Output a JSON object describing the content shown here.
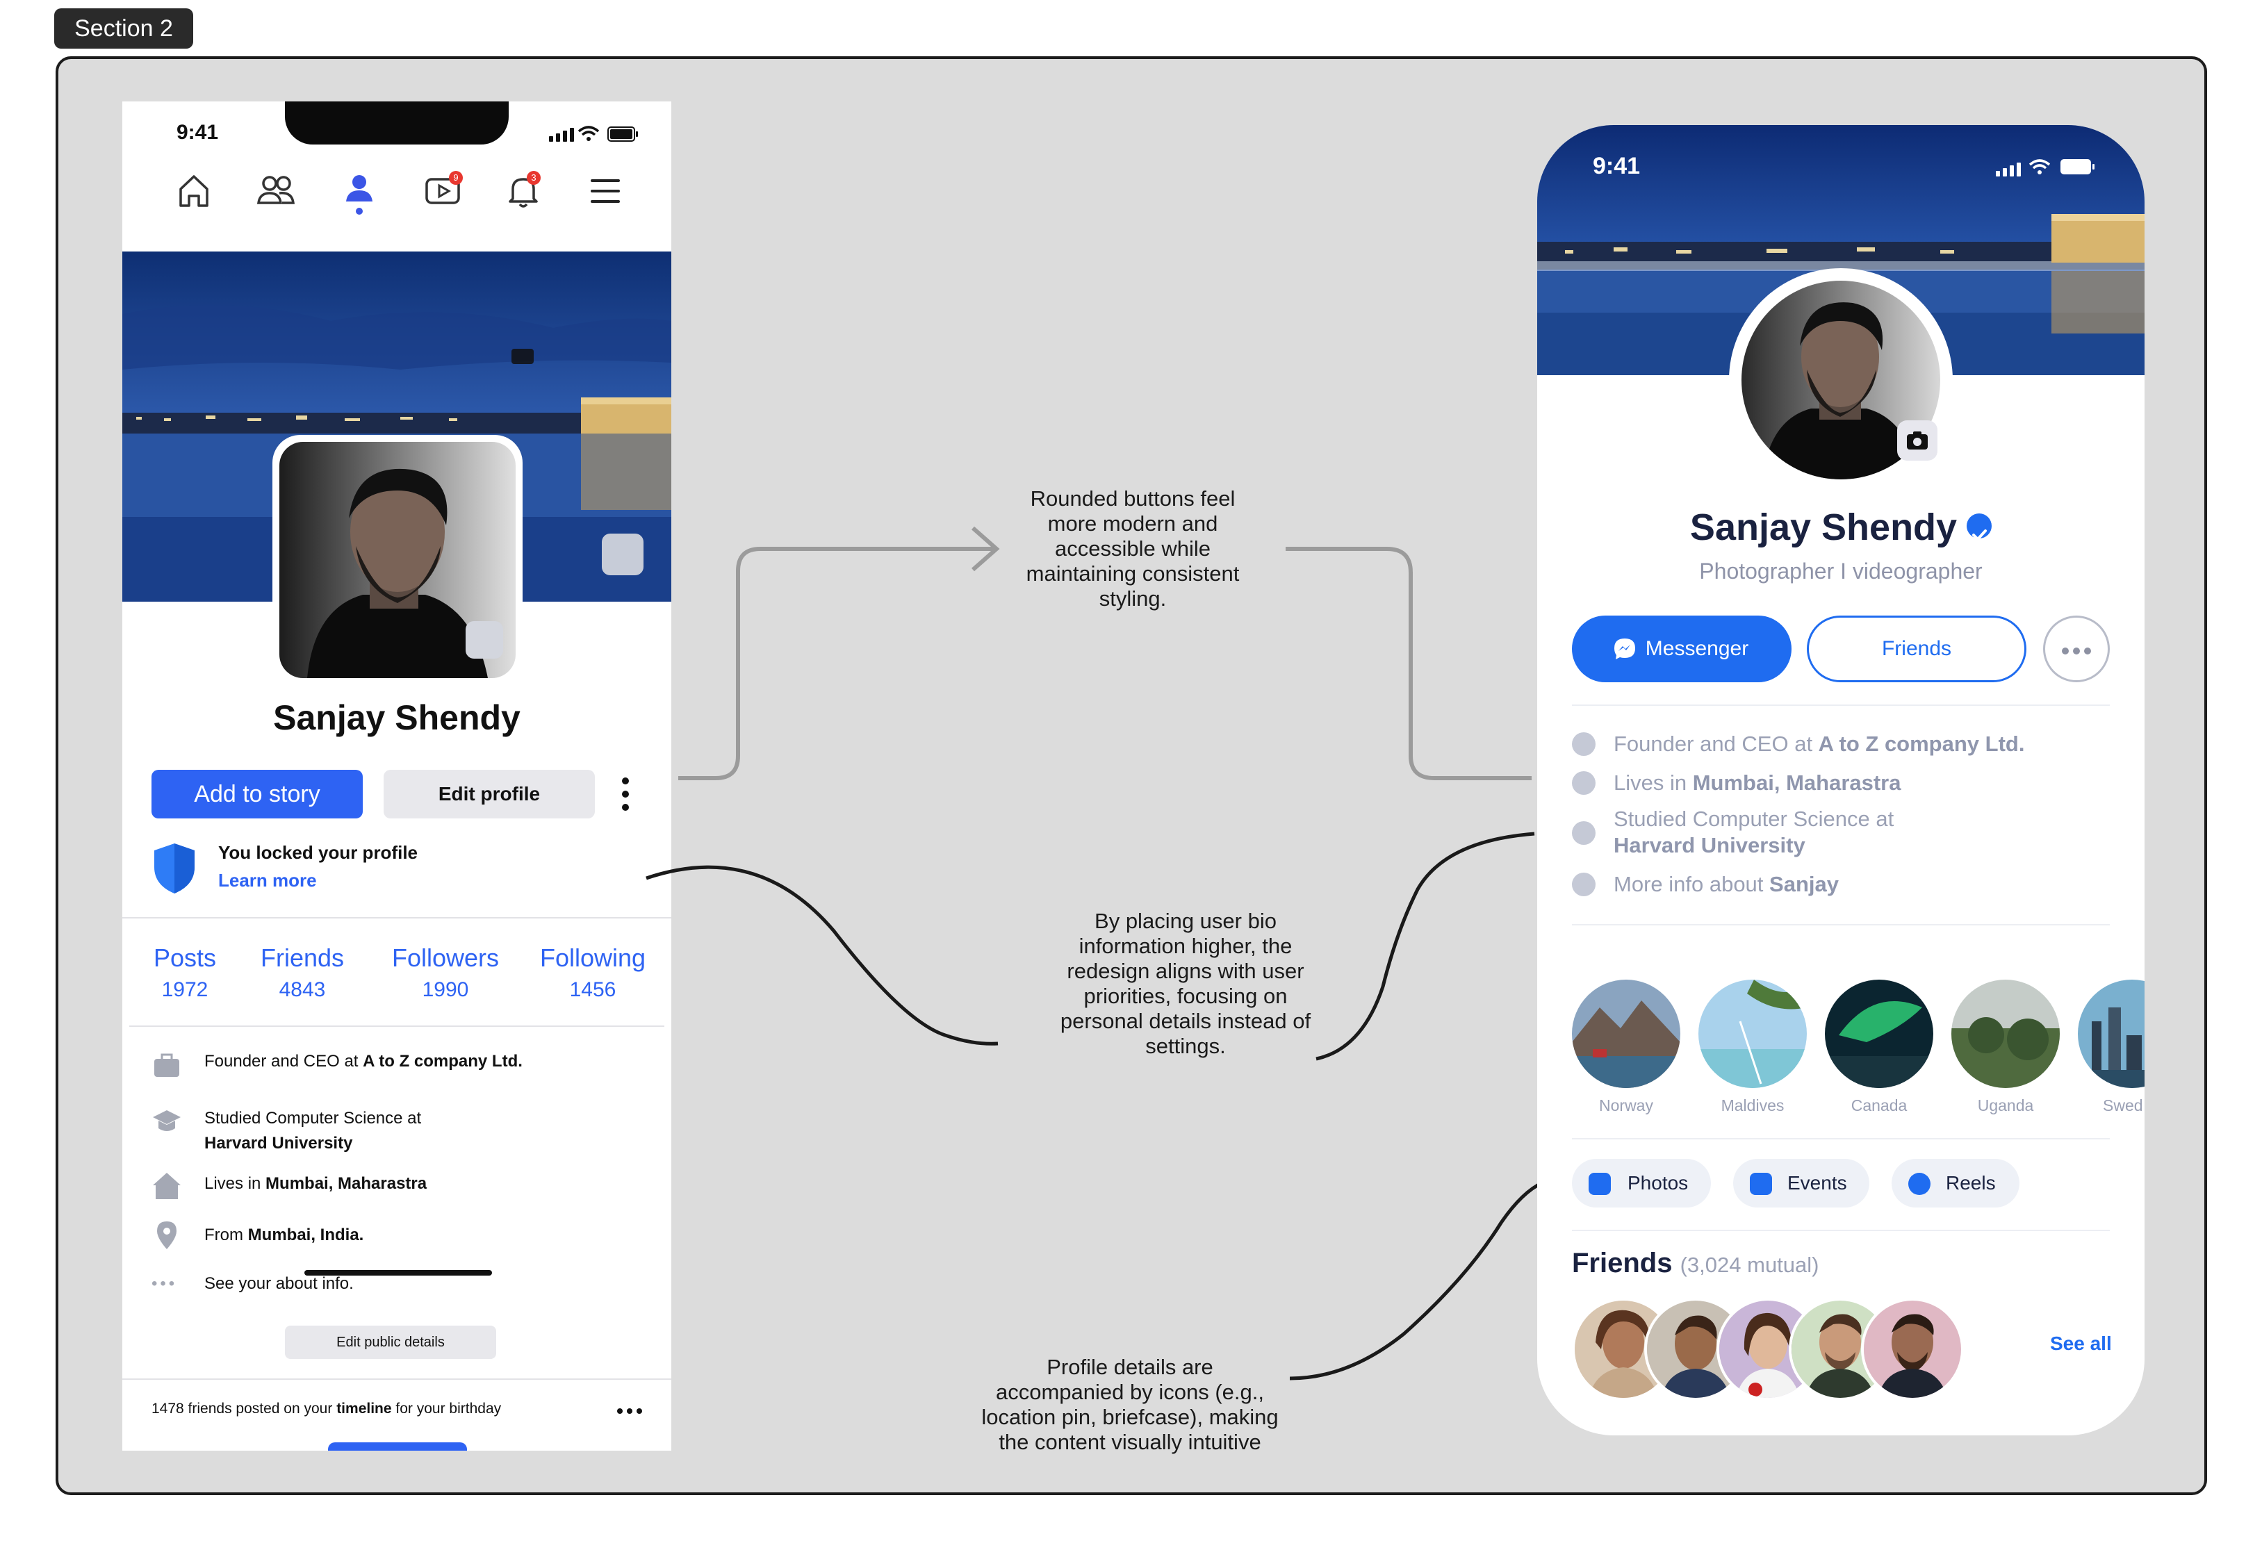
{
  "section_label": "Section 2",
  "left_phone": {
    "time": "9:41",
    "nav_icons": [
      "home-icon",
      "friends-icon",
      "profile-icon",
      "video-icon",
      "bell-icon",
      "menu-icon"
    ],
    "video_badge": "9",
    "bell_badge": "3",
    "name": "Sanjay Shendy",
    "add_story_label": "Add to story",
    "edit_profile_label": "Edit profile",
    "lock_title": "You locked your profile",
    "lock_link": "Learn more",
    "stats": [
      {
        "label": "Posts",
        "value": "1972"
      },
      {
        "label": "Friends",
        "value": "4843"
      },
      {
        "label": "Followers",
        "value": "1990"
      },
      {
        "label": "Following",
        "value": "1456"
      }
    ],
    "details": {
      "work_prefix": "Founder and CEO at ",
      "work_bold": "A to Z company Ltd.",
      "study_line1": "Studied Computer Science at",
      "study_bold": "Harvard University",
      "lives_prefix": "Lives in ",
      "lives_bold": "Mumbai, Maharastra",
      "from_prefix": "From ",
      "from_bold": "Mumbai, India.",
      "about": "See your about info."
    },
    "edit_public_label": "Edit public details",
    "birthday_prefix": "1478 friends posted on your ",
    "birthday_bold": "timeline",
    "birthday_suffix": " for your birthday"
  },
  "annotations": {
    "rounded_buttons": [
      "Rounded buttons feel",
      "more modern and",
      "accessible while",
      "maintaining consistent",
      "styling."
    ],
    "bio_placement": [
      "By placing user bio",
      "information higher, the",
      "redesign aligns with user",
      "priorities, focusing on",
      "personal details instead of",
      "settings."
    ],
    "icons_note": [
      "Profile details are",
      "accompanied by icons (e.g.,",
      "location pin, briefcase), making",
      "the content visually intuitive"
    ]
  },
  "right_phone": {
    "time": "9:41",
    "name": "Sanjay Shendy",
    "subtitle": "Photographer I videographer",
    "messenger_label": "Messenger",
    "friends_label": "Friends",
    "info": {
      "work_prefix": "Founder and CEO at ",
      "work_bold": "A to Z company Ltd.",
      "lives_prefix": "Lives in ",
      "lives_bold": "Mumbai, Maharastra",
      "study_line1": "Studied Computer Science at",
      "study_bold": "Harvard University",
      "more_prefix": "More info about ",
      "more_bold": "Sanjay"
    },
    "places": [
      "Norway",
      "Maldives",
      "Canada",
      "Uganda",
      "Swed"
    ],
    "chips": [
      "Photos",
      "Events",
      "Reels"
    ],
    "friends_title": "Friends",
    "friends_mutual": "(3,024 mutual)",
    "see_all": "See all"
  },
  "colors": {
    "facebook_blue": "#2e63f3",
    "redesign_blue": "#1f6cf0",
    "navy_text": "#1a2240",
    "canvas_gray": "#dcdcdc"
  }
}
